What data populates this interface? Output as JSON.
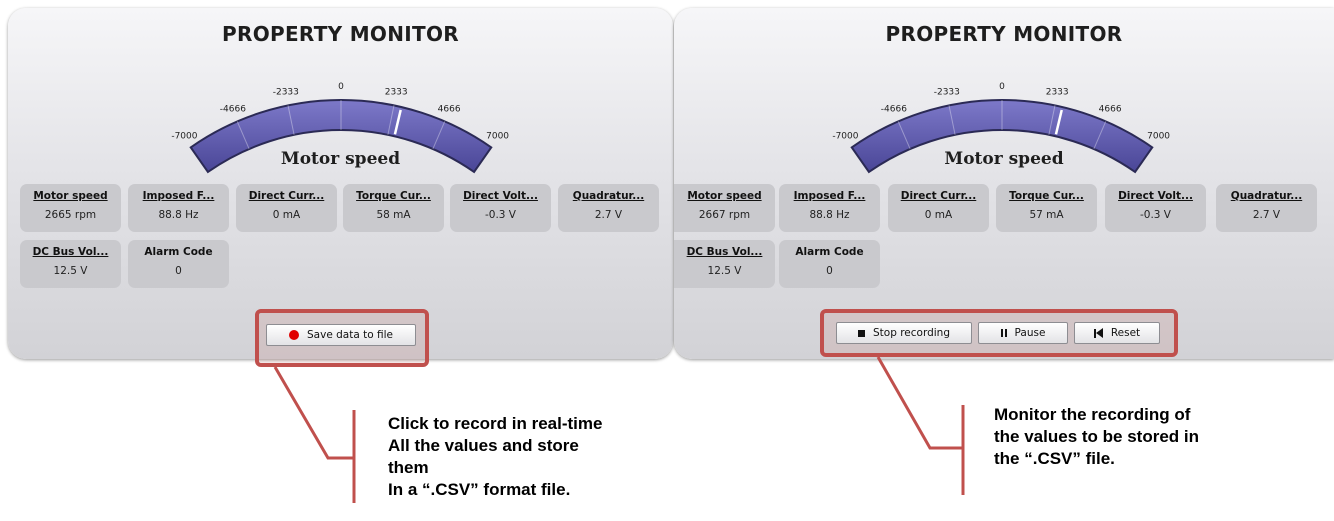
{
  "left_panel": {
    "title": "PROPERTY MONITOR",
    "gauge": {
      "ticks": [
        "-7000",
        "-4666",
        "-2333",
        "0",
        "2333",
        "4666",
        "7000"
      ],
      "min": -7000,
      "max": 7000,
      "value": 2665,
      "label": "Motor speed"
    },
    "cards": [
      {
        "label": "Motor speed",
        "value": "2665 rpm"
      },
      {
        "label": "Imposed F...",
        "value": "88.8 Hz"
      },
      {
        "label": "Direct Curr...",
        "value": "0 mA"
      },
      {
        "label": "Torque Cur...",
        "value": "58 mA"
      },
      {
        "label": "Direct Volt...",
        "value": "-0.3 V"
      },
      {
        "label": "Quadratur...",
        "value": "2.7 V"
      },
      {
        "label": "DC Bus Vol...",
        "value": "12.5 V"
      },
      {
        "label": "Alarm Code",
        "value": "0"
      }
    ],
    "buttons": {
      "save": "Save data to file"
    }
  },
  "right_panel": {
    "title": "PROPERTY MONITOR",
    "gauge": {
      "ticks": [
        "-7000",
        "-4666",
        "-2333",
        "0",
        "2333",
        "4666",
        "7000"
      ],
      "min": -7000,
      "max": 7000,
      "value": 2667,
      "label": "Motor speed"
    },
    "cards": [
      {
        "label": "Motor speed",
        "value": "2667 rpm"
      },
      {
        "label": "Imposed F...",
        "value": "88.8 Hz"
      },
      {
        "label": "Direct Curr...",
        "value": "0 mA"
      },
      {
        "label": "Torque Cur...",
        "value": "57 mA"
      },
      {
        "label": "Direct Volt...",
        "value": "-0.3 V"
      },
      {
        "label": "Quadratur...",
        "value": "2.7 V"
      },
      {
        "label": "DC Bus Vol...",
        "value": "12.5 V"
      },
      {
        "label": "Alarm Code",
        "value": "0"
      }
    ],
    "buttons": {
      "stop": "Stop recording",
      "pause": "Pause",
      "reset": "Reset"
    }
  },
  "annotations": {
    "left": [
      "Click to record in real-time",
      "All the values and store",
      "them",
      "In a “.CSV” format file."
    ],
    "right": [
      "Monitor the recording of",
      "the values to be stored in",
      "the “.CSV” file."
    ]
  },
  "colors": {
    "highlight": "#c0504d",
    "gauge_fill": "#4a4697",
    "record_dot": "#e00000"
  },
  "icons": {
    "save": "record-dot-icon",
    "stop": "stop-icon",
    "pause": "pause-icon",
    "reset": "skip-back-icon"
  }
}
